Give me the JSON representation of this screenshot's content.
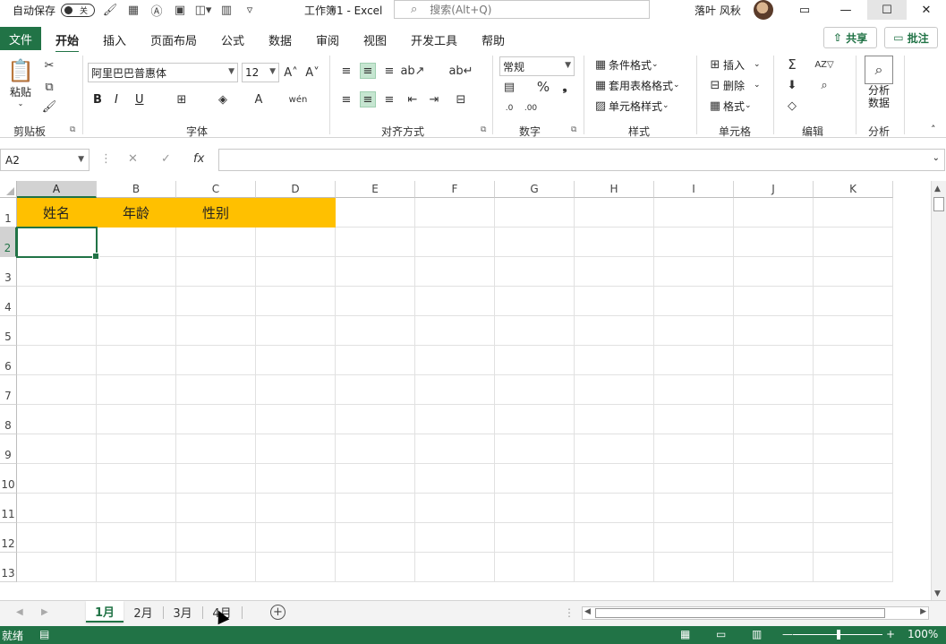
{
  "titlebar": {
    "autosave_label": "自动保存",
    "autosave_state": "关",
    "doc_title": "工作簿1 - Excel",
    "search_placeholder": "搜索(Alt+Q)",
    "user_name": "落叶 风秋"
  },
  "ribbon_tabs": {
    "file": "文件",
    "tabs": [
      "开始",
      "插入",
      "页面布局",
      "公式",
      "数据",
      "审阅",
      "视图",
      "开发工具",
      "帮助"
    ],
    "active": "开始",
    "share": "共享",
    "comment": "批注"
  },
  "ribbon": {
    "clipboard": {
      "paste": "粘贴",
      "label": "剪贴板"
    },
    "font": {
      "font_name": "阿里巴巴普惠体",
      "font_size": "12",
      "label": "字体",
      "bold": "B",
      "italic": "I",
      "underline": "U"
    },
    "alignment": {
      "label": "对齐方式"
    },
    "number": {
      "format": "常规",
      "label": "数字"
    },
    "styles": {
      "conditional": "条件格式",
      "table": "套用表格格式",
      "cell_styles": "单元格样式",
      "label": "样式"
    },
    "cells": {
      "insert": "插入",
      "delete": "删除",
      "format": "格式",
      "label": "单元格"
    },
    "editing": {
      "label": "编辑"
    },
    "analysis": {
      "button_line1": "分析",
      "button_line2": "数据",
      "label": "分析"
    }
  },
  "formula_bar": {
    "name_box": "A2",
    "fx": "fx",
    "formula": ""
  },
  "grid": {
    "columns": [
      "A",
      "B",
      "C",
      "D",
      "E",
      "F",
      "G",
      "H",
      "I",
      "J",
      "K"
    ],
    "rows": [
      "1",
      "2",
      "3",
      "4",
      "5",
      "6",
      "7",
      "8",
      "9",
      "10",
      "11",
      "12",
      "13"
    ],
    "row1": [
      "姓名",
      "年龄",
      "性别",
      ""
    ],
    "header_fill_color": "#FFC000",
    "selected_cell": "A2"
  },
  "sheets": {
    "tabs": [
      "1月",
      "2月",
      "3月",
      "4月"
    ],
    "active": "1月"
  },
  "status": {
    "ready": "就绪",
    "zoom": "100%"
  },
  "colors": {
    "accent": "#217346",
    "header_fill": "#FFC000"
  }
}
